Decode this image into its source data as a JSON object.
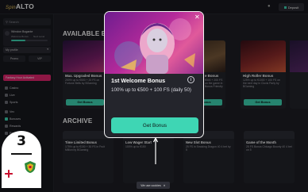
{
  "header": {
    "logo_prefix": "Spin",
    "logo_text": "ALTO",
    "deposit_label": "Deposit"
  },
  "sidebar": {
    "search_placeholder": "Search",
    "user": {
      "name": "Winston Bogante",
      "level_label": "Welcome Bonus",
      "level_value": "Next Level"
    },
    "profile_label": "My profile",
    "tabs": [
      "Promo",
      "VIP"
    ],
    "vip_banner": "Fantasy Hour Activated",
    "nav": [
      "Casino",
      "Live",
      "Sports",
      "",
      "Vex",
      "Bonuses",
      "Rewards",
      "Record"
    ]
  },
  "available": {
    "section_title": "AVAILABLE BONU",
    "cards": [
      {
        "title": "Max. Upgraded Bonus",
        "text": "200% up to €500 + 20 FS on Fortune Bells by BGaming",
        "button": "Get Bonus",
        "color": "#3a1f4d"
      },
      {
        "title": "",
        "text": "",
        "button": "",
        "color": ""
      },
      {
        "title": "",
        "text": "",
        "button": "",
        "color": ""
      },
      {
        "title": "e Bonus",
        "text": "€500 + 200 FS on the game in Bonus Friendly",
        "button": "Get Bonus",
        "color": "#4c3a2a"
      },
      {
        "title": "High Roller Bonus",
        "text": "125% up to €1000 + 100 FS on the next day in Clovis Party by BGaming",
        "button": "Get Bonus",
        "color": "#5b1e2a"
      }
    ]
  },
  "archive": {
    "section_title": "ARCHIVE",
    "cards": [
      {
        "title": "Time Limited Bonus",
        "text": "175% up to €150 + 30 FS in Fruit Million by BGaming"
      },
      {
        "title": "Low Wager Start",
        "text": "100% up to €150"
      },
      {
        "title": "New Slot Bonus",
        "text": "25 FS in Smoking Dragon 40 4 bet by 5"
      },
      {
        "title": "Game of the Month",
        "text": "25 FS Bonus Chicago Bounty 40 4 bet on 5"
      }
    ]
  },
  "modal": {
    "title": "1st Welcome Bonus",
    "description": "100% up to €500 + 100 FS (daily 50)",
    "info_icon": "i",
    "button": "Get Bonus"
  },
  "cookies": {
    "text": "We use cookies",
    "close": "✕"
  },
  "badge": {
    "number": "3"
  }
}
